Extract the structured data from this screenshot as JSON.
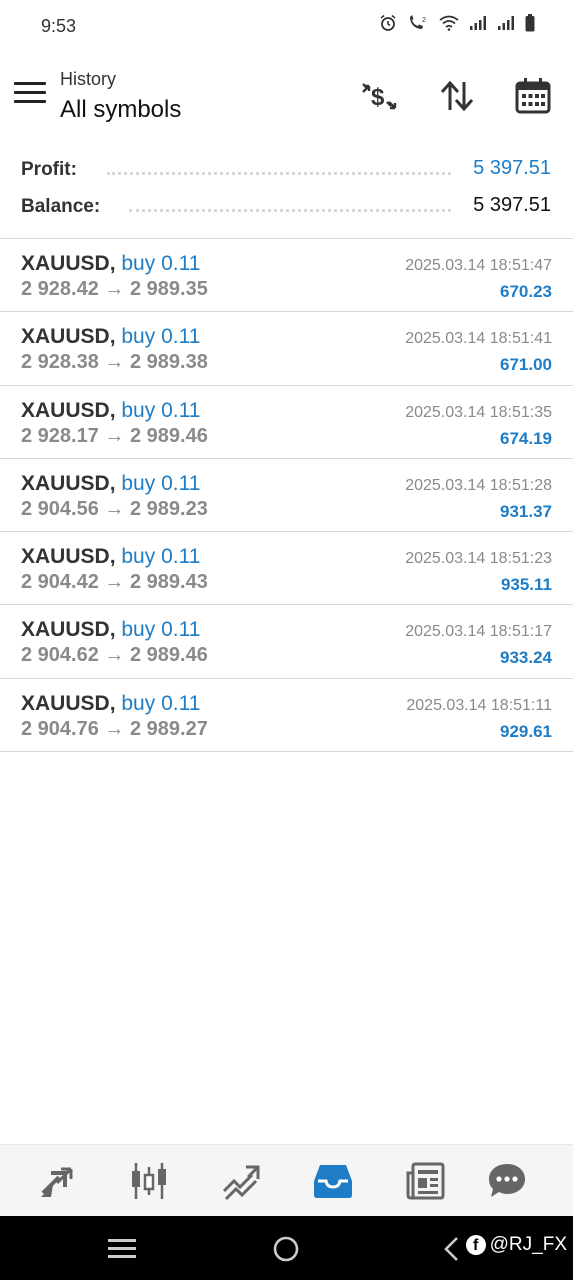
{
  "status_bar": {
    "time": "9:53",
    "icons": [
      "alarm-icon",
      "wifi-calling-icon",
      "wifi-icon",
      "signal-icon",
      "signal-icon-2",
      "battery-icon"
    ]
  },
  "header": {
    "subtitle": "History",
    "title": "All symbols",
    "actions": [
      "currency-exchange-icon",
      "sort-icon",
      "calendar-icon"
    ]
  },
  "summary": {
    "profit_label": "Profit:",
    "profit_value": "5 397.51",
    "balance_label": "Balance:",
    "balance_value": "5 397.51"
  },
  "deals": [
    {
      "symbol": "XAUUSD",
      "sep": ",",
      "type": "buy 0.11",
      "open": "2 928.42",
      "arrow": "→",
      "close": "2 989.35",
      "time": "2025.03.14 18:51:47",
      "profit": "670.23"
    },
    {
      "symbol": "XAUUSD",
      "sep": ",",
      "type": "buy 0.11",
      "open": "2 928.38",
      "arrow": "→",
      "close": "2 989.38",
      "time": "2025.03.14 18:51:41",
      "profit": "671.00"
    },
    {
      "symbol": "XAUUSD",
      "sep": ",",
      "type": "buy 0.11",
      "open": "2 928.17",
      "arrow": "→",
      "close": "2 989.46",
      "time": "2025.03.14 18:51:35",
      "profit": "674.19"
    },
    {
      "symbol": "XAUUSD",
      "sep": ",",
      "type": "buy 0.11",
      "open": "2 904.56",
      "arrow": "→",
      "close": "2 989.23",
      "time": "2025.03.14 18:51:28",
      "profit": "931.37"
    },
    {
      "symbol": "XAUUSD",
      "sep": ",",
      "type": "buy 0.11",
      "open": "2 904.42",
      "arrow": "→",
      "close": "2 989.43",
      "time": "2025.03.14 18:51:23",
      "profit": "935.11"
    },
    {
      "symbol": "XAUUSD",
      "sep": ",",
      "type": "buy 0.11",
      "open": "2 904.62",
      "arrow": "→",
      "close": "2 989.46",
      "time": "2025.03.14 18:51:17",
      "profit": "933.24"
    },
    {
      "symbol": "XAUUSD",
      "sep": ",",
      "type": "buy 0.11",
      "open": "2 904.76",
      "arrow": "→",
      "close": "2 989.27",
      "time": "2025.03.14 18:51:11",
      "profit": "929.61"
    }
  ],
  "bottom_nav": {
    "items": [
      "quotes-icon",
      "chart-icon",
      "trade-icon",
      "history-icon",
      "news-icon",
      "messages-icon"
    ],
    "active": "history-icon"
  },
  "colors": {
    "accent": "#1e7dc6",
    "muted": "#8a8a8a",
    "text": "#333333"
  },
  "system_nav": {
    "watermark": "@RJ_FX",
    "watermark_logo": "f"
  }
}
